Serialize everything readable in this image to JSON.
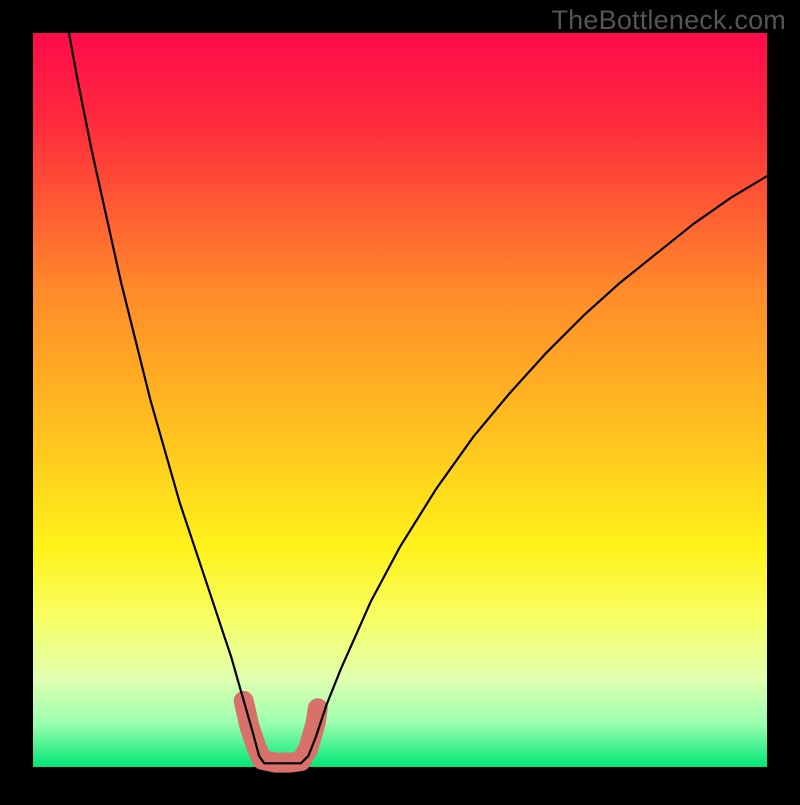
{
  "watermark": "TheBottleneck.com",
  "chart_data": {
    "type": "line",
    "title": "",
    "xlabel": "",
    "ylabel": "",
    "xlim": [
      0,
      100
    ],
    "ylim": [
      0,
      100
    ],
    "background_gradient": {
      "stops": [
        {
          "offset": 0.0,
          "color": "#ff0b4b"
        },
        {
          "offset": 0.12,
          "color": "#ff2a3d"
        },
        {
          "offset": 0.35,
          "color": "#ff8a2a"
        },
        {
          "offset": 0.55,
          "color": "#ffc31f"
        },
        {
          "offset": 0.7,
          "color": "#fff21a"
        },
        {
          "offset": 0.8,
          "color": "#f7ff66"
        },
        {
          "offset": 0.88,
          "color": "#e0ffb0"
        },
        {
          "offset": 0.94,
          "color": "#9cffb0"
        },
        {
          "offset": 1.0,
          "color": "#00e676"
        }
      ]
    },
    "series": [
      {
        "name": "curve",
        "color": "#000000",
        "points": [
          {
            "x": 4.9,
            "y": 100.0
          },
          {
            "x": 6.0,
            "y": 94.0
          },
          {
            "x": 8.0,
            "y": 84.0
          },
          {
            "x": 10.0,
            "y": 75.0
          },
          {
            "x": 12.0,
            "y": 66.0
          },
          {
            "x": 14.0,
            "y": 58.0
          },
          {
            "x": 16.0,
            "y": 50.0
          },
          {
            "x": 18.0,
            "y": 43.0
          },
          {
            "x": 20.0,
            "y": 36.0
          },
          {
            "x": 22.0,
            "y": 30.0
          },
          {
            "x": 24.0,
            "y": 24.0
          },
          {
            "x": 26.0,
            "y": 18.0
          },
          {
            "x": 27.0,
            "y": 15.0
          },
          {
            "x": 28.0,
            "y": 11.5
          },
          {
            "x": 29.0,
            "y": 8.0
          },
          {
            "x": 30.0,
            "y": 4.5
          },
          {
            "x": 30.8,
            "y": 1.5
          },
          {
            "x": 31.5,
            "y": 0.5
          },
          {
            "x": 34.0,
            "y": 0.5
          },
          {
            "x": 36.5,
            "y": 0.5
          },
          {
            "x": 37.5,
            "y": 1.5
          },
          {
            "x": 38.5,
            "y": 4.0
          },
          {
            "x": 40.0,
            "y": 8.5
          },
          {
            "x": 42.0,
            "y": 13.5
          },
          {
            "x": 44.0,
            "y": 18.0
          },
          {
            "x": 46.0,
            "y": 22.5
          },
          {
            "x": 50.0,
            "y": 30.0
          },
          {
            "x": 55.0,
            "y": 38.0
          },
          {
            "x": 60.0,
            "y": 45.0
          },
          {
            "x": 65.0,
            "y": 51.0
          },
          {
            "x": 70.0,
            "y": 56.5
          },
          {
            "x": 75.0,
            "y": 61.5
          },
          {
            "x": 80.0,
            "y": 66.0
          },
          {
            "x": 85.0,
            "y": 70.0
          },
          {
            "x": 90.0,
            "y": 74.0
          },
          {
            "x": 95.0,
            "y": 77.5
          },
          {
            "x": 100.0,
            "y": 80.5
          }
        ]
      },
      {
        "name": "highlight",
        "color": "#d9716b",
        "stroke_width": 20,
        "points": [
          {
            "x": 28.7,
            "y": 9.0
          },
          {
            "x": 29.5,
            "y": 5.5
          },
          {
            "x": 30.5,
            "y": 2.5
          },
          {
            "x": 31.2,
            "y": 1.0
          },
          {
            "x": 33.0,
            "y": 0.6
          },
          {
            "x": 35.0,
            "y": 0.6
          },
          {
            "x": 36.5,
            "y": 0.8
          },
          {
            "x": 37.5,
            "y": 2.5
          },
          {
            "x": 38.5,
            "y": 6.0
          },
          {
            "x": 38.8,
            "y": 8.0
          }
        ]
      }
    ]
  }
}
